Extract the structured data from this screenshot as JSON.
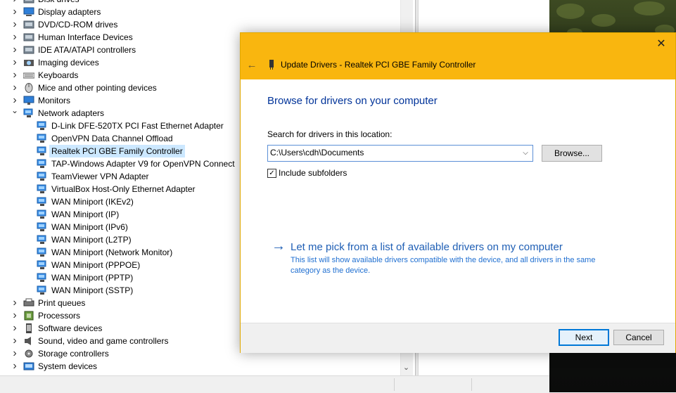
{
  "tree": [
    {
      "kind": "cat",
      "label": "Disk drives",
      "expanded": false,
      "icon": "disk-drive-icon"
    },
    {
      "kind": "cat",
      "label": "Display adapters",
      "expanded": false,
      "icon": "display-adapter-icon"
    },
    {
      "kind": "cat",
      "label": "DVD/CD-ROM drives",
      "expanded": false,
      "icon": "dvd-drive-icon"
    },
    {
      "kind": "cat",
      "label": "Human Interface Devices",
      "expanded": false,
      "icon": "hid-icon"
    },
    {
      "kind": "cat",
      "label": "IDE ATA/ATAPI controllers",
      "expanded": false,
      "icon": "ide-controller-icon"
    },
    {
      "kind": "cat",
      "label": "Imaging devices",
      "expanded": false,
      "icon": "camera-icon"
    },
    {
      "kind": "cat",
      "label": "Keyboards",
      "expanded": false,
      "icon": "keyboard-icon"
    },
    {
      "kind": "cat",
      "label": "Mice and other pointing devices",
      "expanded": false,
      "icon": "mouse-icon"
    },
    {
      "kind": "cat",
      "label": "Monitors",
      "expanded": false,
      "icon": "monitor-icon"
    },
    {
      "kind": "cat",
      "label": "Network adapters",
      "expanded": true,
      "icon": "network-adapter-icon"
    },
    {
      "kind": "child",
      "label": "D-Link DFE-520TX PCI Fast Ethernet Adapter",
      "icon": "network-adapter-icon"
    },
    {
      "kind": "child",
      "label": "OpenVPN Data Channel Offload",
      "icon": "network-adapter-icon"
    },
    {
      "kind": "child",
      "label": "Realtek PCI GBE Family Controller",
      "icon": "network-adapter-icon",
      "selected": true
    },
    {
      "kind": "child",
      "label": "TAP-Windows Adapter V9 for OpenVPN Connect",
      "icon": "network-adapter-icon"
    },
    {
      "kind": "child",
      "label": "TeamViewer VPN Adapter",
      "icon": "network-adapter-icon"
    },
    {
      "kind": "child",
      "label": "VirtualBox Host-Only Ethernet Adapter",
      "icon": "network-adapter-icon"
    },
    {
      "kind": "child",
      "label": "WAN Miniport (IKEv2)",
      "icon": "network-adapter-icon"
    },
    {
      "kind": "child",
      "label": "WAN Miniport (IP)",
      "icon": "network-adapter-icon"
    },
    {
      "kind": "child",
      "label": "WAN Miniport (IPv6)",
      "icon": "network-adapter-icon"
    },
    {
      "kind": "child",
      "label": "WAN Miniport (L2TP)",
      "icon": "network-adapter-icon"
    },
    {
      "kind": "child",
      "label": "WAN Miniport (Network Monitor)",
      "icon": "network-adapter-icon"
    },
    {
      "kind": "child",
      "label": "WAN Miniport (PPPOE)",
      "icon": "network-adapter-icon"
    },
    {
      "kind": "child",
      "label": "WAN Miniport (PPTP)",
      "icon": "network-adapter-icon"
    },
    {
      "kind": "child",
      "label": "WAN Miniport (SSTP)",
      "icon": "network-adapter-icon"
    },
    {
      "kind": "cat",
      "label": "Print queues",
      "expanded": false,
      "icon": "printer-icon"
    },
    {
      "kind": "cat",
      "label": "Processors",
      "expanded": false,
      "icon": "processor-icon"
    },
    {
      "kind": "cat",
      "label": "Software devices",
      "expanded": false,
      "icon": "software-device-icon"
    },
    {
      "kind": "cat",
      "label": "Sound, video and game controllers",
      "expanded": false,
      "icon": "speaker-icon"
    },
    {
      "kind": "cat",
      "label": "Storage controllers",
      "expanded": false,
      "icon": "storage-controller-icon"
    },
    {
      "kind": "cat",
      "label": "System devices",
      "expanded": false,
      "icon": "system-device-icon"
    }
  ],
  "dialog": {
    "title": "Update Drivers - Realtek PCI GBE Family Controller",
    "close_glyph": "✕",
    "back_glyph": "←",
    "heading": "Browse for drivers on your computer",
    "search_label": "Search for drivers in this location:",
    "path_value": "C:\\Users\\cdh\\Documents",
    "browse_label": "Browse...",
    "include_subfolders_label": "Include subfolders",
    "include_subfolders_checked": true,
    "pick_arrow": "→",
    "pick_title": "Let me pick from a list of available drivers on my computer",
    "pick_desc": "This list will show available drivers compatible with the device, and all drivers in the same category as the device.",
    "next_label": "Next",
    "cancel_label": "Cancel"
  },
  "colors": {
    "dialog_header": "#f9b60f",
    "link": "#1f5fb5",
    "heading": "#003399",
    "selection": "#cce8ff"
  }
}
